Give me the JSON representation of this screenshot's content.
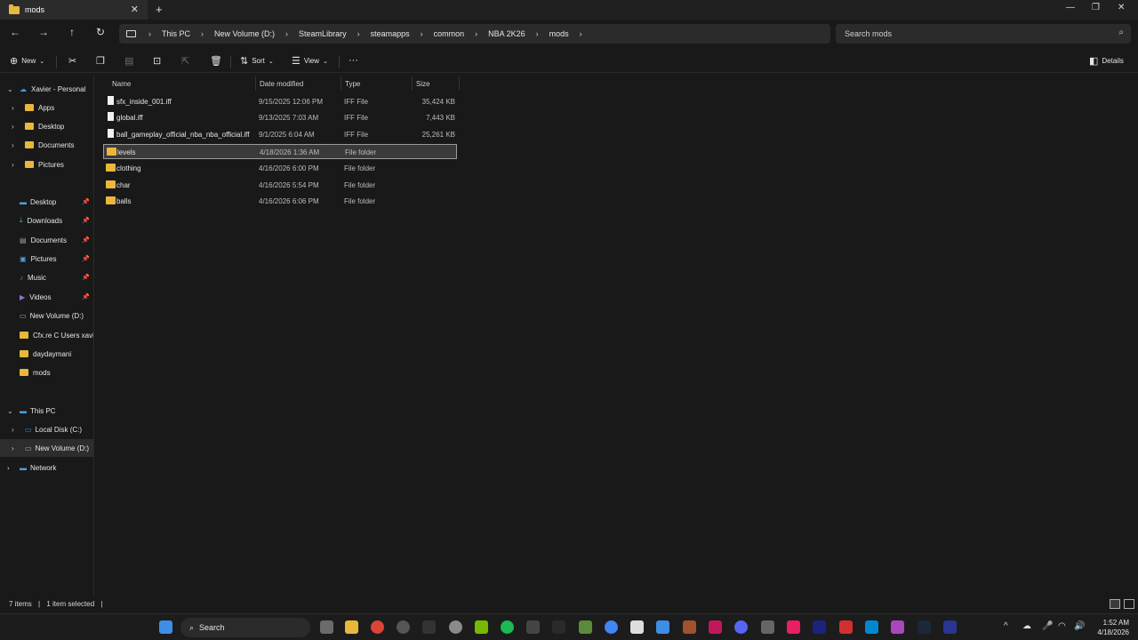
{
  "tab": {
    "title": "mods"
  },
  "breadcrumb": [
    "This PC",
    "New Volume (D:)",
    "SteamLibrary",
    "steamapps",
    "common",
    "NBA 2K26",
    "mods"
  ],
  "search": {
    "placeholder": "Search mods"
  },
  "toolbar": {
    "new_label": "New",
    "sort_label": "Sort",
    "view_label": "View",
    "details_label": "Details"
  },
  "sidebar": {
    "top": [
      {
        "label": "Xavier - Personal",
        "icon": "cloud-icon"
      },
      {
        "label": "Apps"
      },
      {
        "label": "Desktop"
      },
      {
        "label": "Documents"
      },
      {
        "label": "Pictures"
      }
    ],
    "quick": [
      {
        "label": "Desktop",
        "icon": "desktop-icon"
      },
      {
        "label": "Downloads",
        "icon": "download-icon"
      },
      {
        "label": "Documents",
        "icon": "documents-icon"
      },
      {
        "label": "Pictures",
        "icon": "pictures-icon"
      },
      {
        "label": "Music",
        "icon": "music-icon"
      },
      {
        "label": "Videos",
        "icon": "videos-icon"
      },
      {
        "label": "New Volume (D:)",
        "icon": "drive-icon"
      },
      {
        "label": "Cfx.re  C  Users xavi",
        "icon": "folder-icon"
      },
      {
        "label": "daydaymani",
        "icon": "folder-icon"
      },
      {
        "label": "mods",
        "icon": "folder-icon"
      }
    ],
    "pc": [
      {
        "label": "This PC"
      },
      {
        "label": "Local Disk (C:)"
      },
      {
        "label": "New Volume (D:)"
      },
      {
        "label": "Network"
      }
    ]
  },
  "columns": {
    "name": "Name",
    "date": "Date modified",
    "type": "Type",
    "size": "Size"
  },
  "files": [
    {
      "name": "sfx_inside_001.iff",
      "date": "9/15/2025 12:06 PM",
      "type": "IFF File",
      "size": "35,424 KB",
      "kind": "file"
    },
    {
      "name": "global.iff",
      "date": "9/13/2025 7:03 AM",
      "type": "IFF File",
      "size": "7,443 KB",
      "kind": "file"
    },
    {
      "name": "ball_gameplay_official_nba_nba_official.iff",
      "date": "9/1/2025 6:04 AM",
      "type": "IFF File",
      "size": "25,261 KB",
      "kind": "file"
    },
    {
      "name": "levels",
      "date": "4/18/2026 1:36 AM",
      "type": "File folder",
      "size": "",
      "kind": "folder"
    },
    {
      "name": "clothing",
      "date": "4/16/2026 6:00 PM",
      "type": "File folder",
      "size": "",
      "kind": "folder"
    },
    {
      "name": "char",
      "date": "4/16/2026 5:54 PM",
      "type": "File folder",
      "size": "",
      "kind": "folder"
    },
    {
      "name": "balls",
      "date": "4/16/2026 6:06 PM",
      "type": "File folder",
      "size": "",
      "kind": "folder"
    }
  ],
  "selected_index": 3,
  "status": {
    "items": "7 items",
    "selected": "1 item selected"
  },
  "taskbar": {
    "search_label": "Search",
    "time": "1:52 AM",
    "date": "4/18/2026"
  }
}
